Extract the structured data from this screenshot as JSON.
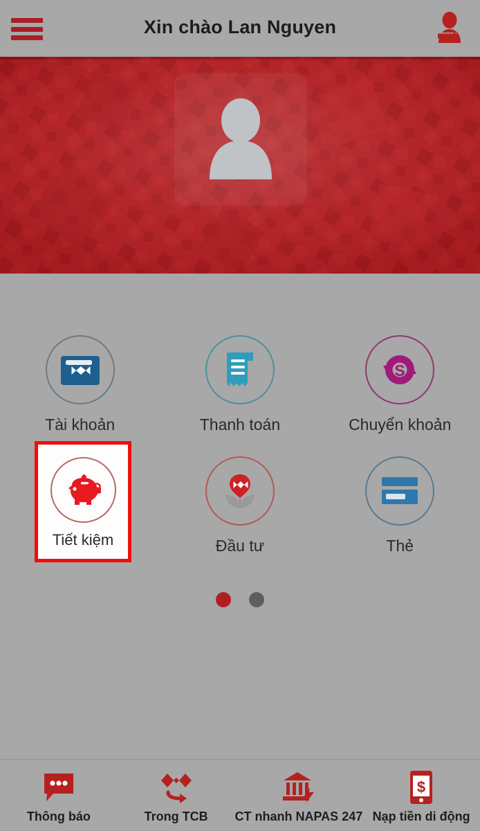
{
  "header": {
    "title": "Xin chào Lan Nguyen",
    "menu_icon": "hamburger-menu-icon",
    "logout_icon": "logout-person-arrow-icon"
  },
  "banner": {
    "avatar_icon": "user-avatar-placeholder-icon",
    "redacted_lines": [
      "",
      "",
      "",
      ""
    ],
    "background_color": "#b01e22"
  },
  "shortcuts": {
    "items": [
      {
        "label": "Tài khoản",
        "icon": "wallet-icon",
        "color": "#1d6090",
        "ring": "gray",
        "highlighted": false
      },
      {
        "label": "Thanh toán",
        "icon": "invoice-icon",
        "color": "#2f9dbb",
        "ring": "teal",
        "highlighted": false
      },
      {
        "label": "Chuyển khoản",
        "icon": "transfer-money-icon",
        "color": "#a11a79",
        "ring": "purple",
        "highlighted": false
      },
      {
        "label": "Tiết kiệm",
        "icon": "piggy-bank-icon",
        "color": "#e8191f",
        "ring": "redb",
        "highlighted": true
      },
      {
        "label": "Đầu tư",
        "icon": "investment-plant-icon",
        "color": "#cf2026",
        "ring": "redb",
        "highlighted": false
      },
      {
        "label": "Thẻ",
        "icon": "credit-card-icon",
        "color": "#2f78ad",
        "ring": "blue",
        "highlighted": false
      }
    ],
    "highlight_border_color": "#f40c0c"
  },
  "pagination": {
    "total": 2,
    "active_index": 0,
    "active_color": "#b01e22",
    "inactive_color": "#5e5e5e"
  },
  "bottom_nav": {
    "items": [
      {
        "label": "Thông báo",
        "icon": "notification-bubble-icon"
      },
      {
        "label": "Trong TCB",
        "icon": "techcombank-transfer-icon"
      },
      {
        "label": "CT nhanh NAPAS 247",
        "icon": "bank-fast-transfer-icon"
      },
      {
        "label": "Nạp tiền di động",
        "icon": "mobile-topup-icon"
      }
    ],
    "icon_color": "#b5211f"
  }
}
